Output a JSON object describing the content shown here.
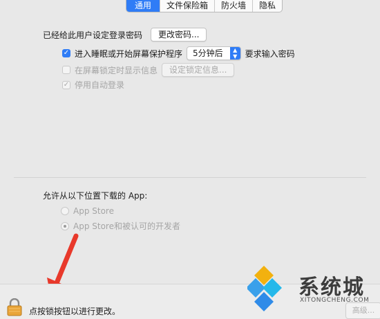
{
  "tabs": [
    "通用",
    "文件保险箱",
    "防火墙",
    "隐私"
  ],
  "password": {
    "label": "已经给此用户设定登录密码",
    "change_button": "更改密码..."
  },
  "sleep": {
    "label": "进入睡眠或开始屏幕保护程序",
    "delay": "5分钟后",
    "suffix": "要求输入密码"
  },
  "lock_message": {
    "label": "在屏幕锁定时显示信息",
    "button": "设定锁定信息..."
  },
  "auto_login": {
    "label": "停用自动登录"
  },
  "downloads": {
    "heading": "允许从以下位置下载的 App:",
    "options": [
      "App Store",
      "App Store和被认可的开发者"
    ],
    "selected": 1
  },
  "footer": {
    "lock_hint": "点按锁按钮以进行更改。",
    "advanced_button": "高级..."
  },
  "watermark": {
    "name": "系统城",
    "domain": "XITONGCHENG.COM"
  },
  "colors": {
    "accent": "#2f7cf6",
    "arrow": "#e8392b",
    "lock": "#e9a53a"
  }
}
